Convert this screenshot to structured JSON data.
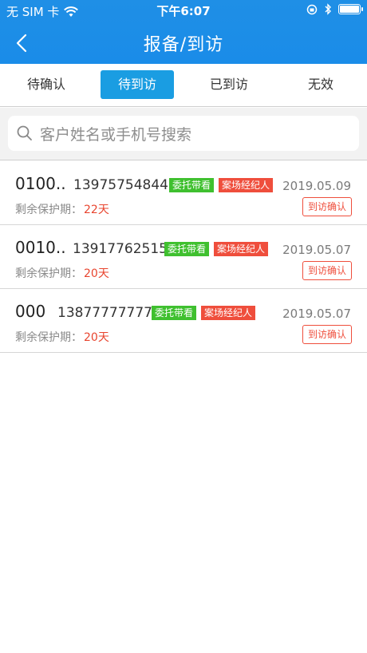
{
  "status_bar": {
    "carrier": "无 SIM 卡",
    "time": "下午6:07"
  },
  "nav": {
    "title": "报备/到访"
  },
  "tabs": [
    {
      "label": "待确认",
      "active": false
    },
    {
      "label": "待到访",
      "active": true
    },
    {
      "label": "已到访",
      "active": false
    },
    {
      "label": "无效",
      "active": false
    }
  ],
  "search": {
    "placeholder": "客户姓名或手机号搜索"
  },
  "records": [
    {
      "name": "0100..",
      "phone": "13975754844",
      "tag1": "委托带看",
      "tag2": "案场经纪人",
      "date": "2019.05.09",
      "protect_label": "剩余保护期：",
      "protect_days": "22天",
      "action": "到访确认"
    },
    {
      "name": "0010..",
      "phone": "13917762515",
      "tag1": "委托带看",
      "tag2": "案场经纪人",
      "date": "2019.05.07",
      "protect_label": "剩余保护期：",
      "protect_days": "20天",
      "action": "到访确认"
    },
    {
      "name": "000",
      "phone": "13877777777",
      "tag1": "委托带看",
      "tag2": "案场经纪人",
      "date": "2019.05.07",
      "protect_label": "剩余保护期：",
      "protect_days": "20天",
      "action": "到访确认"
    }
  ],
  "colors": {
    "header": "#1a8ce8",
    "active_tab": "#1a9de2",
    "tag_green": "#3fc02f",
    "tag_red": "#ef4e3c"
  }
}
